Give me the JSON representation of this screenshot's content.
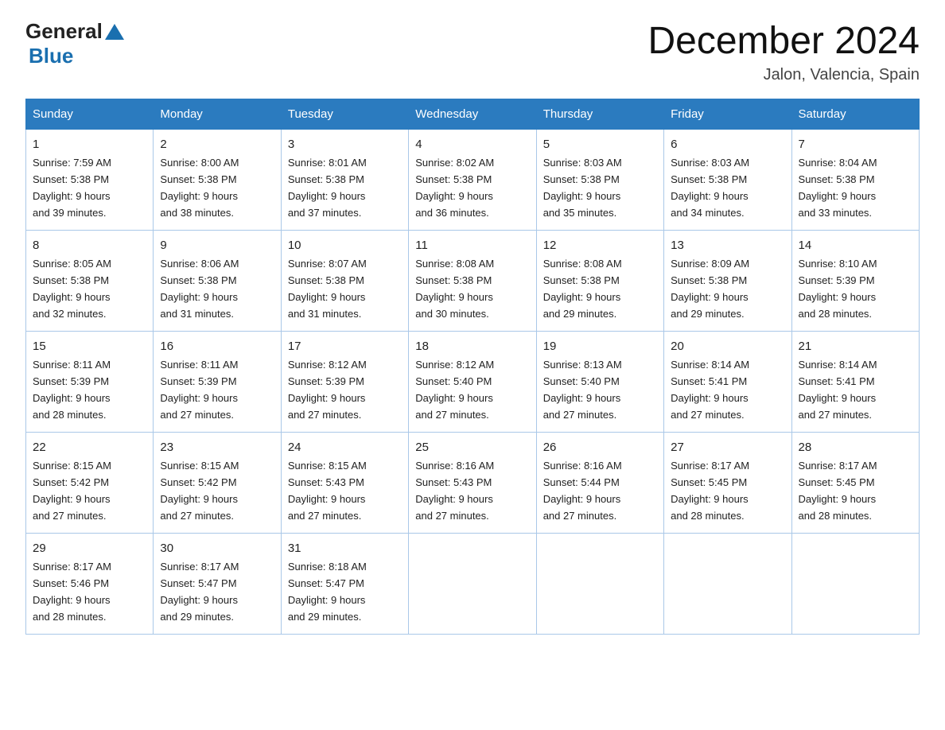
{
  "header": {
    "logo_general": "General",
    "logo_blue": "Blue",
    "month_title": "December 2024",
    "location": "Jalon, Valencia, Spain"
  },
  "weekdays": [
    "Sunday",
    "Monday",
    "Tuesday",
    "Wednesday",
    "Thursday",
    "Friday",
    "Saturday"
  ],
  "weeks": [
    [
      {
        "day": "1",
        "sunrise": "7:59 AM",
        "sunset": "5:38 PM",
        "daylight": "9 hours and 39 minutes."
      },
      {
        "day": "2",
        "sunrise": "8:00 AM",
        "sunset": "5:38 PM",
        "daylight": "9 hours and 38 minutes."
      },
      {
        "day": "3",
        "sunrise": "8:01 AM",
        "sunset": "5:38 PM",
        "daylight": "9 hours and 37 minutes."
      },
      {
        "day": "4",
        "sunrise": "8:02 AM",
        "sunset": "5:38 PM",
        "daylight": "9 hours and 36 minutes."
      },
      {
        "day": "5",
        "sunrise": "8:03 AM",
        "sunset": "5:38 PM",
        "daylight": "9 hours and 35 minutes."
      },
      {
        "day": "6",
        "sunrise": "8:03 AM",
        "sunset": "5:38 PM",
        "daylight": "9 hours and 34 minutes."
      },
      {
        "day": "7",
        "sunrise": "8:04 AM",
        "sunset": "5:38 PM",
        "daylight": "9 hours and 33 minutes."
      }
    ],
    [
      {
        "day": "8",
        "sunrise": "8:05 AM",
        "sunset": "5:38 PM",
        "daylight": "9 hours and 32 minutes."
      },
      {
        "day": "9",
        "sunrise": "8:06 AM",
        "sunset": "5:38 PM",
        "daylight": "9 hours and 31 minutes."
      },
      {
        "day": "10",
        "sunrise": "8:07 AM",
        "sunset": "5:38 PM",
        "daylight": "9 hours and 31 minutes."
      },
      {
        "day": "11",
        "sunrise": "8:08 AM",
        "sunset": "5:38 PM",
        "daylight": "9 hours and 30 minutes."
      },
      {
        "day": "12",
        "sunrise": "8:08 AM",
        "sunset": "5:38 PM",
        "daylight": "9 hours and 29 minutes."
      },
      {
        "day": "13",
        "sunrise": "8:09 AM",
        "sunset": "5:38 PM",
        "daylight": "9 hours and 29 minutes."
      },
      {
        "day": "14",
        "sunrise": "8:10 AM",
        "sunset": "5:39 PM",
        "daylight": "9 hours and 28 minutes."
      }
    ],
    [
      {
        "day": "15",
        "sunrise": "8:11 AM",
        "sunset": "5:39 PM",
        "daylight": "9 hours and 28 minutes."
      },
      {
        "day": "16",
        "sunrise": "8:11 AM",
        "sunset": "5:39 PM",
        "daylight": "9 hours and 27 minutes."
      },
      {
        "day": "17",
        "sunrise": "8:12 AM",
        "sunset": "5:39 PM",
        "daylight": "9 hours and 27 minutes."
      },
      {
        "day": "18",
        "sunrise": "8:12 AM",
        "sunset": "5:40 PM",
        "daylight": "9 hours and 27 minutes."
      },
      {
        "day": "19",
        "sunrise": "8:13 AM",
        "sunset": "5:40 PM",
        "daylight": "9 hours and 27 minutes."
      },
      {
        "day": "20",
        "sunrise": "8:14 AM",
        "sunset": "5:41 PM",
        "daylight": "9 hours and 27 minutes."
      },
      {
        "day": "21",
        "sunrise": "8:14 AM",
        "sunset": "5:41 PM",
        "daylight": "9 hours and 27 minutes."
      }
    ],
    [
      {
        "day": "22",
        "sunrise": "8:15 AM",
        "sunset": "5:42 PM",
        "daylight": "9 hours and 27 minutes."
      },
      {
        "day": "23",
        "sunrise": "8:15 AM",
        "sunset": "5:42 PM",
        "daylight": "9 hours and 27 minutes."
      },
      {
        "day": "24",
        "sunrise": "8:15 AM",
        "sunset": "5:43 PM",
        "daylight": "9 hours and 27 minutes."
      },
      {
        "day": "25",
        "sunrise": "8:16 AM",
        "sunset": "5:43 PM",
        "daylight": "9 hours and 27 minutes."
      },
      {
        "day": "26",
        "sunrise": "8:16 AM",
        "sunset": "5:44 PM",
        "daylight": "9 hours and 27 minutes."
      },
      {
        "day": "27",
        "sunrise": "8:17 AM",
        "sunset": "5:45 PM",
        "daylight": "9 hours and 28 minutes."
      },
      {
        "day": "28",
        "sunrise": "8:17 AM",
        "sunset": "5:45 PM",
        "daylight": "9 hours and 28 minutes."
      }
    ],
    [
      {
        "day": "29",
        "sunrise": "8:17 AM",
        "sunset": "5:46 PM",
        "daylight": "9 hours and 28 minutes."
      },
      {
        "day": "30",
        "sunrise": "8:17 AM",
        "sunset": "5:47 PM",
        "daylight": "9 hours and 29 minutes."
      },
      {
        "day": "31",
        "sunrise": "8:18 AM",
        "sunset": "5:47 PM",
        "daylight": "9 hours and 29 minutes."
      },
      null,
      null,
      null,
      null
    ]
  ],
  "labels": {
    "sunrise": "Sunrise:",
    "sunset": "Sunset:",
    "daylight": "Daylight:"
  }
}
